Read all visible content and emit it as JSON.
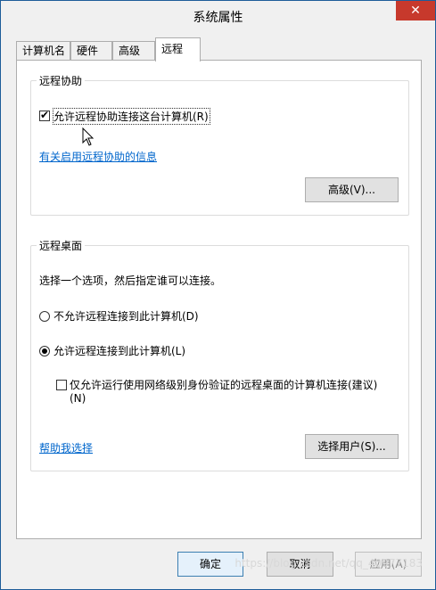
{
  "window": {
    "title": "系统属性",
    "close_glyph": "✕"
  },
  "tabs": [
    {
      "label": "计算机名",
      "active": false
    },
    {
      "label": "硬件",
      "active": false
    },
    {
      "label": "高级",
      "active": false
    },
    {
      "label": "远程",
      "active": true
    }
  ],
  "remote_assistance": {
    "title": "远程协助",
    "allow_checkbox": {
      "label": "允许远程协助连接这台计算机(R)",
      "checked": true
    },
    "info_link": "有关启用远程协助的信息",
    "advanced_button": "高级(V)..."
  },
  "remote_desktop": {
    "title": "远程桌面",
    "instruction": "选择一个选项，然后指定谁可以连接。",
    "option_deny": {
      "label": "不允许远程连接到此计算机(D)",
      "selected": false
    },
    "option_allow": {
      "label": "允许远程连接到此计算机(L)",
      "selected": true
    },
    "nla_checkbox": {
      "label_line1": "仅允许运行使用网络级别身份验证的远程桌面的计算机连接(建议)",
      "label_line2": "(N)",
      "checked": false
    },
    "help_link": "帮助我选择",
    "select_users_button": "选择用户(S)..."
  },
  "footer": {
    "ok": "确定",
    "cancel": "取消",
    "apply": "应用(A)",
    "apply_disabled": true
  },
  "watermark": "https://blog.csdn.net/qq_40977183"
}
